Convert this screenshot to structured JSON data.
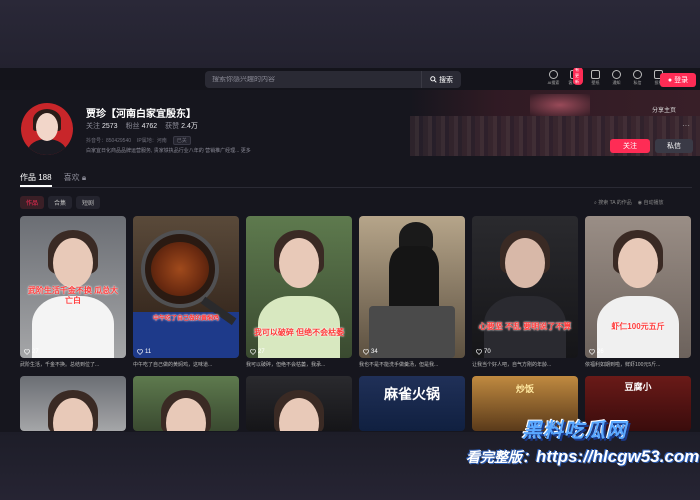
{
  "header": {
    "search_placeholder": "搜索你感兴趣的内容",
    "search_label": "搜索",
    "icons": [
      {
        "name": "ai-search-icon",
        "label": "AI搜索"
      },
      {
        "name": "client-icon",
        "label": "客户端",
        "badge": "有更新"
      },
      {
        "name": "wallpaper-icon",
        "label": "壁纸"
      },
      {
        "name": "notification-icon",
        "label": "通知"
      },
      {
        "name": "message-icon",
        "label": "私信"
      },
      {
        "name": "upload-icon",
        "label": "投稿"
      }
    ],
    "login_label": "登录"
  },
  "profile": {
    "name": "贾珍【河南白家宜殷东】",
    "following_label": "关注",
    "following_count": "2573",
    "followers_label": "粉丝",
    "followers_count": "4762",
    "likes_label": "获赞",
    "likes_count": "2.4万",
    "account_id": "抖音号：850429540",
    "ip_location": "IP属地：河南",
    "tag": "已关",
    "bio": "白家宜日化商品品牌运营服务, 贵家铁执品行业八年的 营销推广经理... 更多",
    "share_label": "分享主页",
    "more_label": "···",
    "follow_label": "关注",
    "message_label": "私信"
  },
  "tabs": [
    {
      "label": "作品 188",
      "active": true
    },
    {
      "label": "喜欢",
      "lock": true,
      "active": false
    }
  ],
  "filters": [
    {
      "label": "作品",
      "active": true
    },
    {
      "label": "合集",
      "active": false
    },
    {
      "label": "短剧",
      "active": false
    }
  ],
  "right_tools": {
    "search_label": "搜索 TA 的作品",
    "autoplay_label": "自动播放"
  },
  "videos": [
    {
      "likes": "27",
      "overlay": "武阶生活千金不换 瓜总大亡白",
      "caption": "武阶生活，千金不换。总结到位了..."
    },
    {
      "likes": "11",
      "overlay": "中午吃了自己做的黄焖鸡",
      "caption": "中午吃了自己做的黄焖鸡，这味道..."
    },
    {
      "likes": "27",
      "overlay": "我可以破碎 但绝不会枯萎",
      "caption": "我可以破碎，但绝不会枯萎，我承..."
    },
    {
      "likes": "34",
      "overlay": "",
      "caption": "我也不是不能洗手做羹汤，但是我..."
    },
    {
      "likes": "70",
      "overlay": "心要坚 不乱 要明说了不算",
      "caption": "让我当个好人吧，自气方刚的年龄..."
    },
    {
      "likes": "26",
      "overlay": "虾仁100元五斤",
      "caption": "依福利如期到啦，鲜虾100元5斤..."
    },
    {
      "likes": "",
      "overlay": "",
      "caption": ""
    },
    {
      "likes": "",
      "overlay": "",
      "caption": ""
    },
    {
      "likes": "",
      "overlay": "",
      "caption": ""
    },
    {
      "likes": "",
      "overlay": "麻雀火锅",
      "caption": ""
    },
    {
      "likes": "",
      "overlay": "炒饭",
      "caption": ""
    },
    {
      "likes": "",
      "overlay": "豆腐小",
      "caption": ""
    }
  ],
  "watermark": {
    "logo": "黑料吃瓜网",
    "url_prefix": "看完整版：",
    "url": "https://hlcgw53.com"
  }
}
